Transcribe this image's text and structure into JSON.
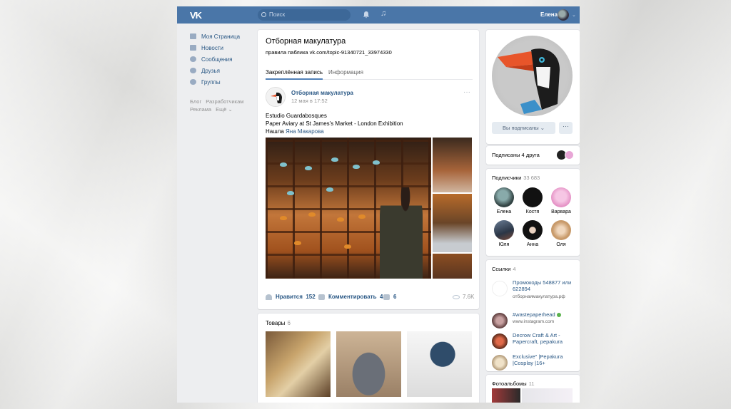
{
  "topbar": {
    "logo": "VK",
    "search_placeholder": "Поиск",
    "user_name": "Елена"
  },
  "nav": {
    "items": [
      {
        "label": "Моя Страница",
        "icon": "home-icon"
      },
      {
        "label": "Новости",
        "icon": "news-icon"
      },
      {
        "label": "Сообщения",
        "icon": "messages-icon"
      },
      {
        "label": "Друзья",
        "icon": "friends-icon"
      },
      {
        "label": "Группы",
        "icon": "groups-icon"
      }
    ],
    "footer": [
      "Блог",
      "Разработчикам",
      "Реклама",
      "Ещё ⌄"
    ]
  },
  "group": {
    "title": "Отборная макулатура",
    "subtitle": "правила паблика vk.com/topic-91340721_33974330",
    "tabs": [
      "Закреплённая запись",
      "Информация"
    ]
  },
  "post": {
    "author": "Отборная макулатура",
    "date": "12 мая в 17:52",
    "text_lines": [
      "Estudio Guardabosques",
      "Paper Aviary at St James's Market - London Exhibition"
    ],
    "found_prefix": "Нашла",
    "found_name": "Яна Макарова",
    "likes_label": "Нравится",
    "likes_count": "152",
    "comments_label": "Комментировать",
    "comments_count": "4",
    "shares_count": "6",
    "views": "7.6K"
  },
  "goods": {
    "title": "Товары",
    "count": "6"
  },
  "profile": {
    "subscribed_label": "Вы подписаны ⌄",
    "more_label": "···",
    "friends_label": "Подписаны 4 друга"
  },
  "subscribers": {
    "title": "Подписчики",
    "count": "33 683",
    "people": [
      "Елена",
      "Костя",
      "Варвара",
      "Юля",
      "Анна",
      "Оля"
    ]
  },
  "links": {
    "title": "Ссылки",
    "count": "4",
    "items": [
      {
        "title": "Промокоды 548877 или 622894",
        "sub": "отборнаямакулатура.рф"
      },
      {
        "title": "#wastepaperhead",
        "sub": "www.instagram.com"
      },
      {
        "title": "Decrow Craft & Art - Papercraft, pepakura",
        "sub": ""
      },
      {
        "title": "Exclusive\" |Pepakura |Cosplay |16+",
        "sub": ""
      }
    ]
  },
  "albums": {
    "title": "Фотоальбомы",
    "count": "11"
  },
  "colors": {
    "accent": "#4a76a8",
    "link": "#2a5885",
    "bg": "#edeef0"
  }
}
